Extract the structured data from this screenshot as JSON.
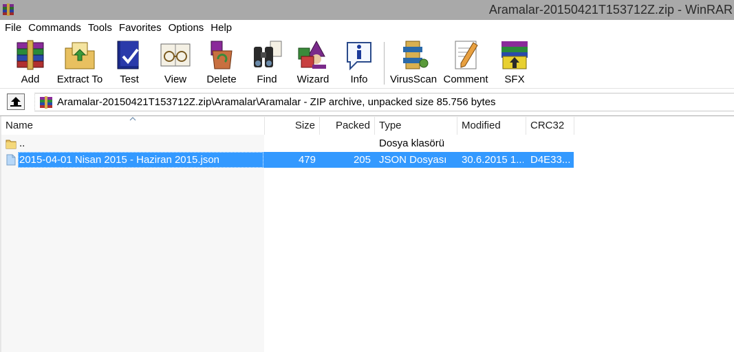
{
  "window": {
    "title": "Aramalar-20150421T153712Z.zip - WinRAR",
    "accent": "#3399ff",
    "titlebar_color": "#a9a9a9"
  },
  "menu": [
    "File",
    "Commands",
    "Tools",
    "Favorites",
    "Options",
    "Help"
  ],
  "toolbar": {
    "buttons": [
      {
        "label": "Add",
        "icon": "add-archive-icon"
      },
      {
        "label": "Extract To",
        "icon": "extract-folder-icon"
      },
      {
        "label": "Test",
        "icon": "test-book-icon"
      },
      {
        "label": "View",
        "icon": "view-glasses-icon"
      },
      {
        "label": "Delete",
        "icon": "delete-recycle-icon"
      },
      {
        "label": "Find",
        "icon": "find-binoculars-icon"
      },
      {
        "label": "Wizard",
        "icon": "wizard-icon"
      },
      {
        "label": "Info",
        "icon": "info-icon"
      },
      {
        "label": "VirusScan",
        "icon": "virusscan-icon"
      },
      {
        "label": "Comment",
        "icon": "comment-pen-icon"
      },
      {
        "label": "SFX",
        "icon": "sfx-box-icon"
      }
    ]
  },
  "address": {
    "path": "Aramalar-20150421T153712Z.zip\\Aramalar\\Aramalar - ZIP archive, unpacked size 85.756 bytes"
  },
  "columns": {
    "name": "Name",
    "size": "Size",
    "packed": "Packed",
    "type": "Type",
    "modified": "Modified",
    "crc": "CRC32"
  },
  "rows": [
    {
      "name": "..",
      "size": "",
      "packed": "",
      "type": "Dosya klasörü",
      "modified": "",
      "crc": "",
      "icon": "folder-icon",
      "selected": false
    },
    {
      "name": "2015-04-01 Nisan 2015 - Haziran 2015.json",
      "size": "479",
      "packed": "205",
      "type": "JSON Dosyası",
      "modified": "30.6.2015 1...",
      "crc": "D4E33...",
      "icon": "file-icon",
      "selected": true
    }
  ]
}
